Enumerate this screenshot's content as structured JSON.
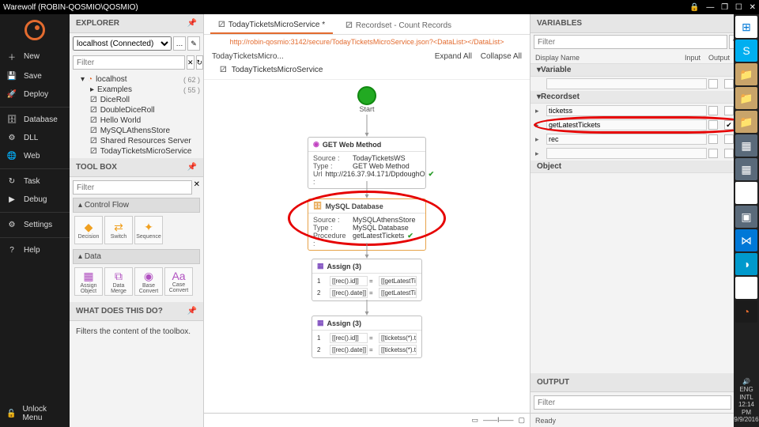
{
  "window": {
    "title": "Warewolf (ROBIN-QOSMIO\\QOSMIO)"
  },
  "sidebar": {
    "items": [
      {
        "icon": "＋",
        "label": "New"
      },
      {
        "icon": "💾",
        "label": "Save"
      },
      {
        "icon": "🚀",
        "label": "Deploy"
      },
      {
        "icon": "🗄",
        "label": "Database"
      },
      {
        "icon": "⚙",
        "label": "DLL"
      },
      {
        "icon": "🌐",
        "label": "Web"
      },
      {
        "icon": "↻",
        "label": "Task"
      },
      {
        "icon": "▶",
        "label": "Debug"
      },
      {
        "icon": "⚙",
        "label": "Settings"
      },
      {
        "icon": "?",
        "label": "Help"
      }
    ],
    "unlock": "Unlock Menu"
  },
  "explorer": {
    "title": "EXPLORER",
    "connection": "localhost (Connected)",
    "filter_ph": "Filter",
    "tree": {
      "root": {
        "label": "localhost",
        "count": "( 62 )"
      },
      "items": [
        {
          "label": "Examples",
          "count": "( 55 )"
        },
        {
          "label": "DiceRoll"
        },
        {
          "label": "DoubleDiceRoll"
        },
        {
          "label": "Hello World"
        },
        {
          "label": "MySQLAthensStore"
        },
        {
          "label": "Shared Resources Server"
        },
        {
          "label": "TodayTicketsMicroService"
        }
      ]
    }
  },
  "toolbox": {
    "title": "TOOL BOX",
    "filter_ph": "Filter",
    "groups": {
      "control_flow": {
        "title": "Control Flow",
        "tools": [
          "Decision",
          "Switch",
          "Sequence"
        ]
      },
      "data": {
        "title": "Data",
        "tools": [
          "Assign Object",
          "Data Merge",
          "Base Convert",
          "Case Convert"
        ]
      }
    }
  },
  "helpbox": {
    "title": "WHAT DOES THIS DO?",
    "text": "Filters the content of the toolbox."
  },
  "canvas": {
    "tabs": [
      {
        "label": "TodayTicketsMicroService *"
      },
      {
        "label": "Recordset - Count Records"
      }
    ],
    "url": "http://robin-qosmio:3142/secure/TodayTicketsMicroService.json?<DataList></DataList>",
    "breadcrumb": "TodayTicketsMicro...",
    "expand": "Expand All",
    "collapse": "Collapse All",
    "service_name": "TodayTicketsMicroService",
    "start": "Start",
    "nodes": {
      "web": {
        "title": "GET Web Method",
        "rows": [
          [
            "Source :",
            "TodayTicketsWS"
          ],
          [
            "Type :",
            "GET Web Method"
          ],
          [
            "Url :",
            "http://216.37.94.171/DpdoughO"
          ]
        ]
      },
      "db": {
        "title": "MySQL Database",
        "rows": [
          [
            "Source :",
            "MySQLAthensStore"
          ],
          [
            "Type :",
            "MySQL Database"
          ],
          [
            "Procedure :",
            "getLatestTickets"
          ]
        ]
      },
      "assign1": {
        "title": "Assign (3)",
        "rows": [
          [
            "1",
            "[[rec().id]]",
            "=",
            "[[getLatestTic"
          ],
          [
            "2",
            "[[rec().date]]",
            "=",
            "[[getLatestTic"
          ]
        ]
      },
      "assign2": {
        "title": "Assign (3)",
        "rows": [
          [
            "1",
            "[[rec().id]]",
            "=",
            "[[ticketss(*).tic"
          ],
          [
            "2",
            "[[rec().date]]",
            "=",
            "[[ticketss(*).tic"
          ]
        ]
      }
    }
  },
  "variables": {
    "title": "VARIABLES",
    "filter_ph": "Filter",
    "cols": {
      "name": "Display Name",
      "input": "Input",
      "output": "Output"
    },
    "groups": {
      "variable": "Variable",
      "recordset": "Recordset",
      "object": "Object"
    },
    "recordsets": [
      "ticketss",
      "getLatestTickets",
      "rec",
      ""
    ]
  },
  "output": {
    "title": "OUTPUT",
    "filter_ph": "Filter"
  },
  "status": {
    "left": "",
    "ready": "Ready"
  },
  "clock": {
    "lang": "ENG",
    "region": "INTL",
    "time": "12:14 PM",
    "date": "9/9/2016"
  }
}
